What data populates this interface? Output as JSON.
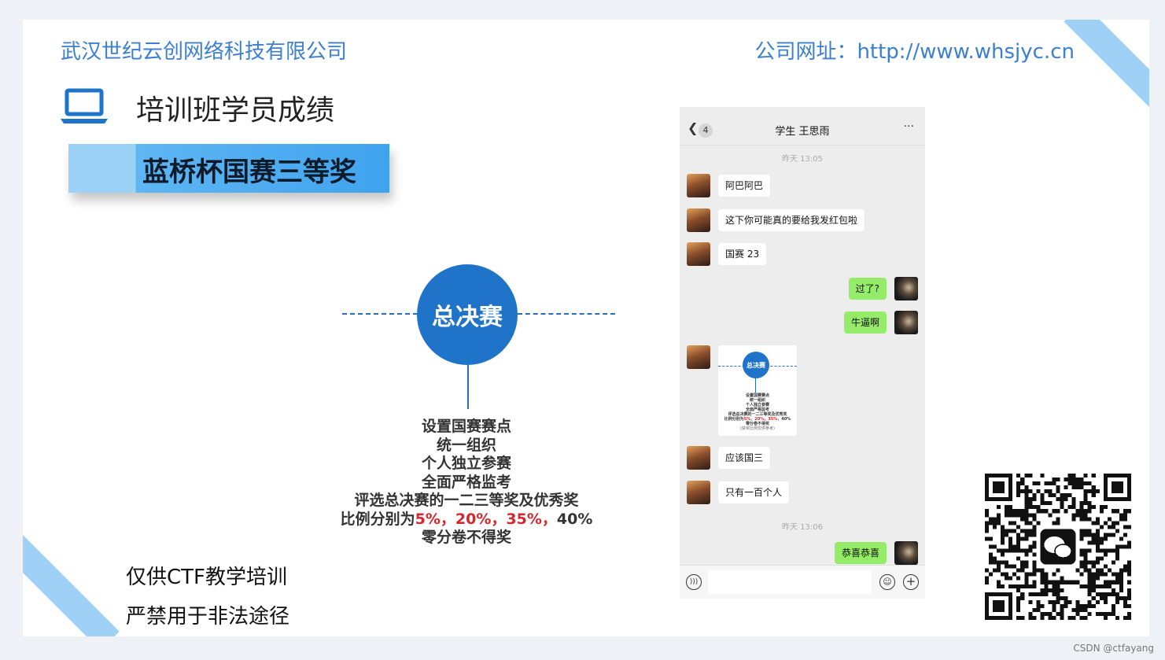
{
  "header": {
    "company": "武汉世纪云创网络科技有限公司",
    "website": "公司网址：http://www.whsjyc.cn"
  },
  "section": {
    "title": "培训班学员成绩",
    "banner": "蓝桥杯国赛三等奖"
  },
  "diagram": {
    "circle_label": "总决赛",
    "lines": [
      "设置国赛赛点",
      "统一组织",
      "个人独立参赛",
      "全面严格监考",
      "评选总决赛的一二三等奖及优秀奖"
    ],
    "ratio_prefix": "比例分别为",
    "ratio_red": "5%，20%，35%，",
    "ratio_rest": "40%",
    "last_line": "零分卷不得奖"
  },
  "disclaimer": {
    "line1": "仅供CTF教学培训",
    "line2": "严禁用于非法途径"
  },
  "chat": {
    "back_icon": "chevron-left-icon",
    "unread": "4",
    "title": "学生 王思雨",
    "more": "···",
    "time1": "昨天 13:05",
    "messages": [
      {
        "from": "other",
        "text": "阿巴阿巴"
      },
      {
        "from": "other",
        "text": "这下你可能真的要给我发红包啦"
      },
      {
        "from": "other",
        "text": "国赛 23"
      },
      {
        "from": "me",
        "text": "过了?"
      },
      {
        "from": "me",
        "text": "牛逼啊"
      },
      {
        "from": "other",
        "text": "应该国三"
      },
      {
        "from": "other",
        "text": "只有一百个人"
      },
      {
        "from": "me",
        "text": "恭喜恭喜"
      }
    ],
    "time2": "昨天 13:06",
    "mini_image": {
      "circle": "总决赛",
      "lines": [
        "设置国赛赛点",
        "统一组织",
        "个人独立参赛",
        "全面严格监考",
        "评选总决赛的一二三等奖及优秀奖"
      ],
      "ratio_prefix": "比例分别为",
      "ratio_red": "5%，20%，35%，",
      "ratio_rest": "40%",
      "last": "零分卷不得奖",
      "note": "(获奖比例仅供参考)"
    }
  },
  "watermark": "CSDN @ctfayang",
  "colors": {
    "accent": "#3b7fd0",
    "circle": "#1f74c9",
    "bubble_me": "#95ec69",
    "stripe": "#9fd0f5"
  }
}
